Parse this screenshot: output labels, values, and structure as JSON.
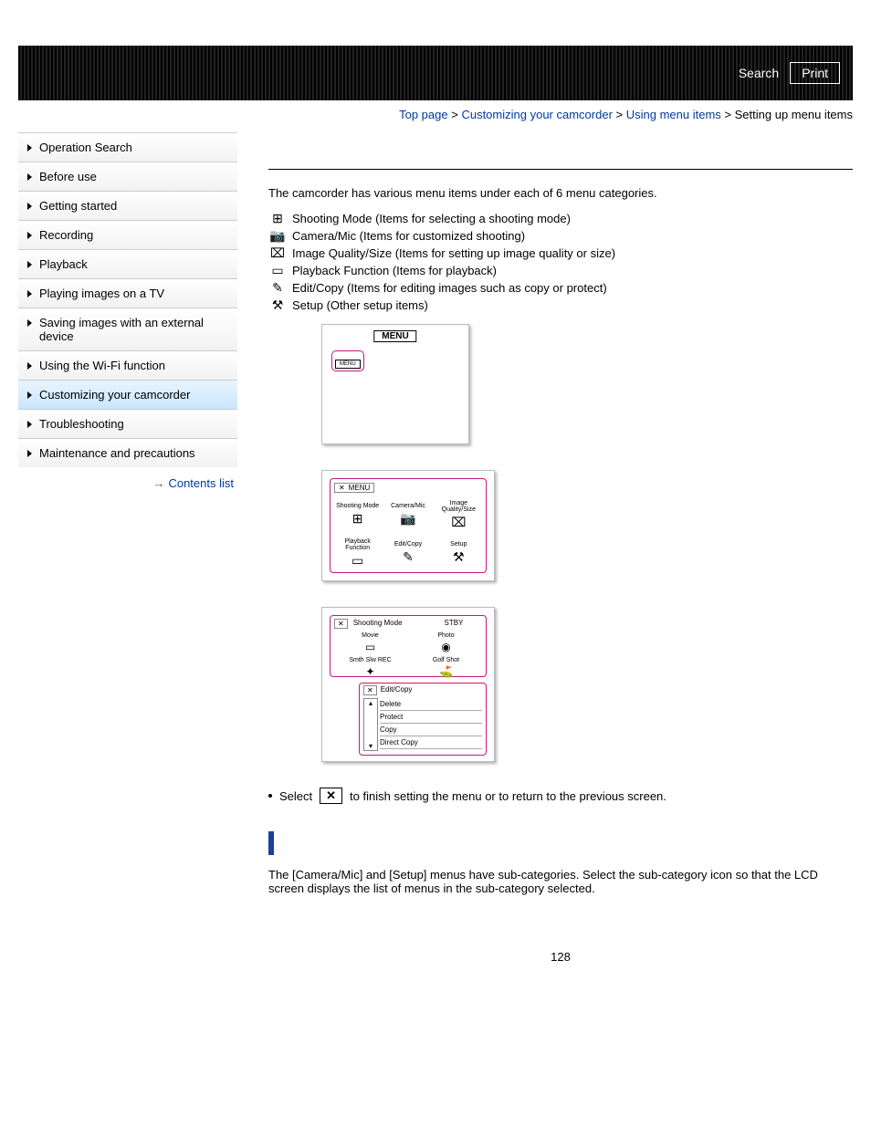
{
  "topbar": {
    "search": "Search",
    "print": "Print"
  },
  "breadcrumbs": {
    "top": "Top page",
    "b1": "Customizing your camcorder",
    "b2": "Using menu items",
    "b3": "Setting up menu items"
  },
  "sidebar": {
    "items": [
      "Operation Search",
      "Before use",
      "Getting started",
      "Recording",
      "Playback",
      "Playing images on a TV",
      "Saving images with an external device",
      "Using the Wi-Fi function",
      "Customizing your camcorder",
      "Troubleshooting",
      "Maintenance and precautions"
    ],
    "contents": "Contents list"
  },
  "main": {
    "intro": "The camcorder has various menu items under each of 6 menu categories.",
    "cats": [
      "Shooting Mode (Items for selecting a shooting mode)",
      "Camera/Mic (Items for customized shooting)",
      "Image Quality/Size (Items for setting up image quality or size)",
      "Playback Function (Items for playback)",
      "Edit/Copy (Items for editing images such as copy or protect)",
      "Setup (Other setup items)"
    ],
    "menu_label": "MENU",
    "ill1_btn": "MENU",
    "ill2": {
      "title": "MENU",
      "cells": [
        "Shooting Mode",
        "Camera/Mic",
        "Image Quality/Size",
        "Playback Function",
        "Edit/Copy",
        "Setup"
      ]
    },
    "ill3": {
      "top_title": "Shooting Mode",
      "top_status": "STBY",
      "top_cells": [
        "Movie",
        "Photo",
        "Smth Slw REC",
        "Golf Shot"
      ],
      "bot_title": "Edit/Copy",
      "bot_rows": [
        "Delete",
        "Protect",
        "Copy",
        "Direct Copy"
      ]
    },
    "finish_pre": "Select",
    "finish_post": "to finish setting the menu or to return to the previous screen.",
    "subnote": "The [Camera/Mic] and [Setup] menus have sub-categories. Select the sub-category icon so that the LCD screen displays the list of menus in the sub-category selected."
  },
  "page_number": "128"
}
